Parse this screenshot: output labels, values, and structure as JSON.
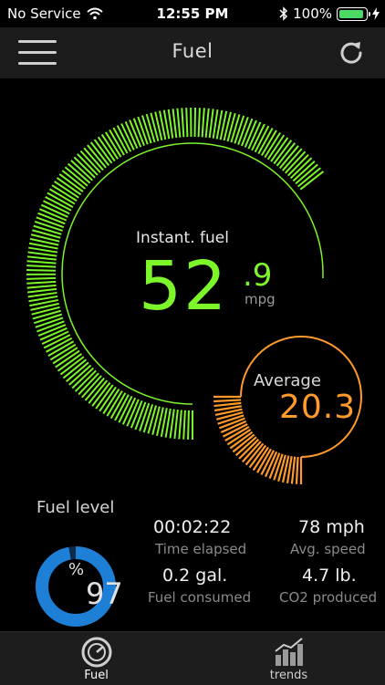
{
  "status_bar": {
    "carrier": "No Service",
    "time": "12:55 PM",
    "battery": "100%"
  },
  "nav": {
    "title": "Fuel",
    "menu_icon": "hamburger-menu-icon",
    "refresh_icon": "refresh-icon"
  },
  "instant": {
    "label": "Instant. fuel",
    "value_int": "52",
    "value_dec": ".9",
    "unit": "mpg"
  },
  "average": {
    "label": "Average",
    "value": "20.3"
  },
  "fuel_level": {
    "label": "Fuel level",
    "percent_symbol": "%",
    "value": "97"
  },
  "stats": {
    "time_elapsed_value": "00:02:22",
    "time_elapsed_label": "Time elapsed",
    "avg_speed_value": "78 mph",
    "avg_speed_label": "Avg. speed",
    "fuel_consumed_value": "0.2 gal.",
    "fuel_consumed_label": "Fuel consumed",
    "co2_value": "4.7 lb.",
    "co2_label": "CO2 produced"
  },
  "tabs": [
    {
      "label": "Fuel",
      "icon": "fuel-gauge-icon",
      "active": true
    },
    {
      "label": "trends",
      "icon": "trends-chart-icon",
      "active": false
    }
  ],
  "colors": {
    "instant": "#7cf52a",
    "average": "#ff9a2b",
    "fuel_ring": "#1e7fd6",
    "battery": "#4cd964"
  }
}
